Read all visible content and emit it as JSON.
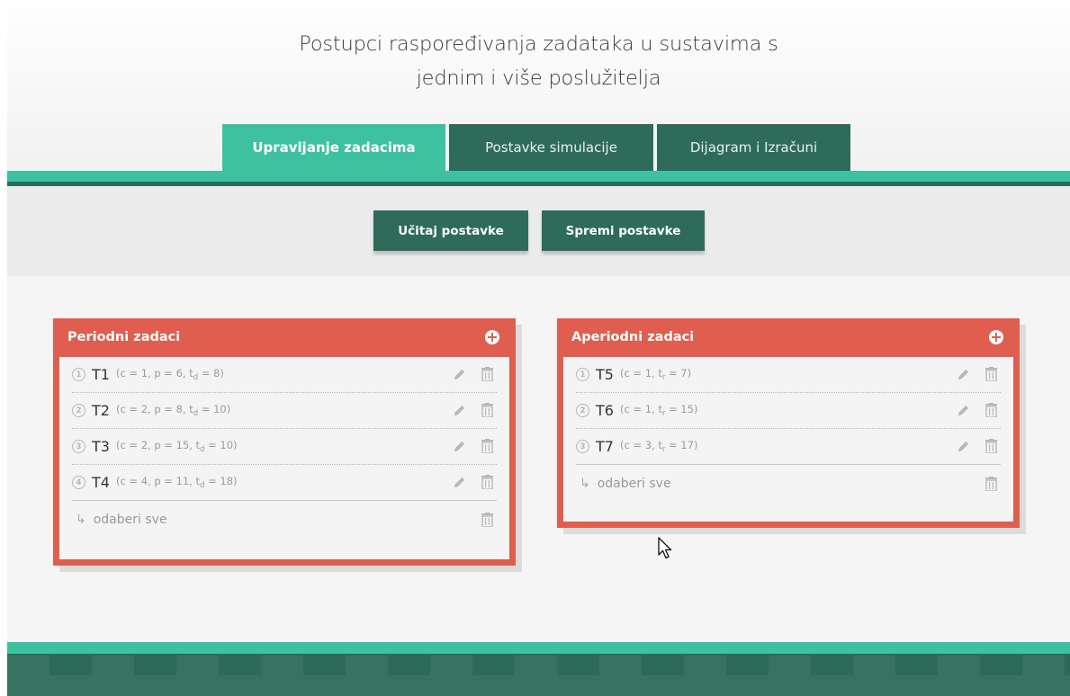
{
  "header": {
    "title_line1": "Postupci raspoređivanja zadataka u sustavima s",
    "title_line2": "jednim i više poslužitelja"
  },
  "tabs": [
    {
      "label": "Upravljanje zadacima",
      "active": true
    },
    {
      "label": "Postavke simulacije",
      "active": false
    },
    {
      "label": "Dijagram i Izračuni",
      "active": false
    }
  ],
  "toolbar": {
    "load_label": "Učitaj postavke",
    "save_label": "Spremi postavke"
  },
  "periodic": {
    "title": "Periodni zadaci",
    "add_icon": "plus-circle-icon",
    "tasks": [
      {
        "num": "1",
        "name": "T1",
        "params_pre": "(c = 1, p = 6, t",
        "sub": "d",
        "params_post": " = 8)"
      },
      {
        "num": "2",
        "name": "T2",
        "params_pre": "(c = 2, p = 8, t",
        "sub": "d",
        "params_post": " = 10)"
      },
      {
        "num": "3",
        "name": "T3",
        "params_pre": "(c = 2, p = 15, t",
        "sub": "d",
        "params_post": " = 10)"
      },
      {
        "num": "4",
        "name": "T4",
        "params_pre": "(c = 4, p = 11, t",
        "sub": "d",
        "params_post": " = 18)"
      }
    ],
    "select_all": "odaberi sve"
  },
  "aperiodic": {
    "title": "Aperiodni zadaci",
    "add_icon": "plus-circle-icon",
    "tasks": [
      {
        "num": "1",
        "name": "T5",
        "params_pre": "(c = 1, t",
        "sub": "r",
        "params_post": " = 7)"
      },
      {
        "num": "2",
        "name": "T6",
        "params_pre": "(c = 1, t",
        "sub": "r",
        "params_post": " = 15)"
      },
      {
        "num": "3",
        "name": "T7",
        "params_pre": "(c = 3, t",
        "sub": "r",
        "params_post": " = 17)"
      }
    ],
    "select_all": "odaberi sve"
  },
  "colors": {
    "accent": "#3ec1a1",
    "dark": "#2f6b5b",
    "panel": "#e05e4f"
  }
}
